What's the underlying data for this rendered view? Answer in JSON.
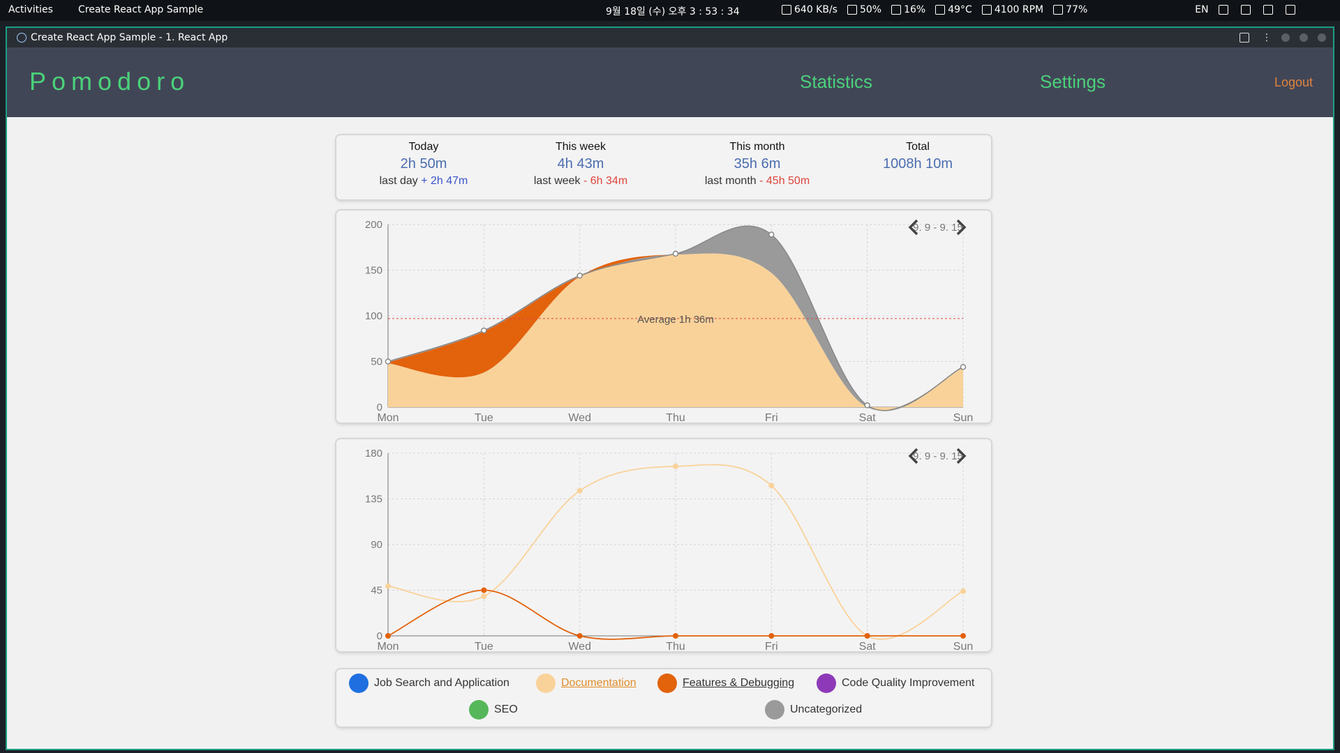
{
  "system_bar": {
    "activities": "Activities",
    "app_title": "Create React App Sample",
    "clock": "9월 18일 (수) 오후 3 : 53 : 34",
    "net": "640 KB/s",
    "battery": "50%",
    "disk": "16%",
    "temp": "49°C",
    "fan": "4100 RPM",
    "weather": "77%",
    "lang": "EN"
  },
  "window": {
    "title": "Create React App Sample - 1. React App"
  },
  "header": {
    "logo": "Pomodoro",
    "nav_statistics": "Statistics",
    "nav_settings": "Settings",
    "logout": "Logout"
  },
  "summary": [
    {
      "label": "Today",
      "value": "2h 50m",
      "cmp_label": "last day",
      "cmp_sign": "+",
      "cmp_value": "2h 47m"
    },
    {
      "label": "This week",
      "value": "4h 43m",
      "cmp_label": "last week",
      "cmp_sign": "-",
      "cmp_value": "6h 34m"
    },
    {
      "label": "This month",
      "value": "35h 6m",
      "cmp_label": "last month",
      "cmp_sign": "-",
      "cmp_value": "45h 50m"
    },
    {
      "label": "Total",
      "value": "1008h 10m"
    }
  ],
  "colors": {
    "green": "#4bd17a",
    "documentation": "#f9d29a",
    "features": "#e3620c",
    "uncategorized": "#9a9a9a",
    "job": "#1f6fe0",
    "code_quality": "#8e3ab8",
    "seo": "#56b75a",
    "average": "#e0443c"
  },
  "chart_data": [
    {
      "type": "area",
      "date_range": "9. 9 - 9. 15",
      "categories": [
        "Mon",
        "Tue",
        "Wed",
        "Thu",
        "Fri",
        "Sat",
        "Sun"
      ],
      "ylim": [
        0,
        200
      ],
      "yticks": [
        0,
        50,
        100,
        150,
        200
      ],
      "average_label": "Average 1h 36m",
      "average_value": 97,
      "stacked": true,
      "series": [
        {
          "name": "Documentation",
          "values": [
            48,
            38,
            143,
            167,
            147,
            0,
            43
          ]
        },
        {
          "name": "Features & Debugging",
          "values": [
            1,
            45,
            0,
            0,
            0,
            0,
            0
          ]
        },
        {
          "name": "Uncategorized",
          "values": [
            1,
            1,
            1,
            1,
            42,
            2,
            1
          ]
        }
      ]
    },
    {
      "type": "line",
      "date_range": "9. 9 - 9. 15",
      "categories": [
        "Mon",
        "Tue",
        "Wed",
        "Thu",
        "Fri",
        "Sat",
        "Sun"
      ],
      "ylim": [
        0,
        180
      ],
      "yticks": [
        0,
        45,
        90,
        135,
        180
      ],
      "series": [
        {
          "name": "Documentation",
          "values": [
            49,
            39,
            143,
            167,
            148,
            0,
            44
          ]
        },
        {
          "name": "Features & Debugging",
          "values": [
            0,
            45,
            0,
            0,
            0,
            0,
            0
          ]
        }
      ]
    }
  ],
  "legend": [
    {
      "label": "Job Search and Application",
      "color": "#1f6fe0",
      "style": "normal"
    },
    {
      "label": "Documentation",
      "color": "#f9d29a",
      "style": "highlight"
    },
    {
      "label": "Features & Debugging",
      "color": "#e3620c",
      "style": "underline"
    },
    {
      "label": "Code Quality Improvement",
      "color": "#8e3ab8",
      "style": "normal"
    },
    {
      "label": "SEO",
      "color": "#56b75a",
      "style": "normal"
    },
    {
      "label": "Uncategorized",
      "color": "#9a9a9a",
      "style": "normal"
    }
  ]
}
